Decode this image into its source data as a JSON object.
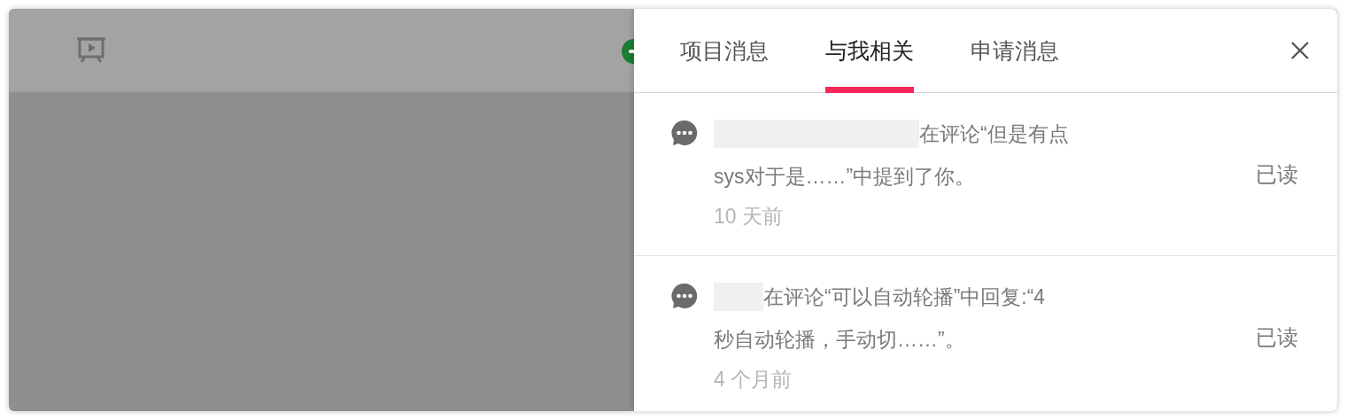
{
  "panel": {
    "tabs": [
      {
        "label": "项目消息",
        "selected": false
      },
      {
        "label": "与我相关",
        "selected": true
      },
      {
        "label": "申请消息",
        "selected": false
      }
    ],
    "messages": [
      {
        "lines": [
          "在评论“但是有点",
          "sys对于是……”中提到了你。"
        ],
        "time": "10 天前",
        "status": "已读"
      },
      {
        "lines": [
          "在评论“可以自动轮播”中回复:“4",
          "秒自动轮播，手动切……”。"
        ],
        "time": "4 个月前",
        "status": "已读"
      }
    ]
  }
}
